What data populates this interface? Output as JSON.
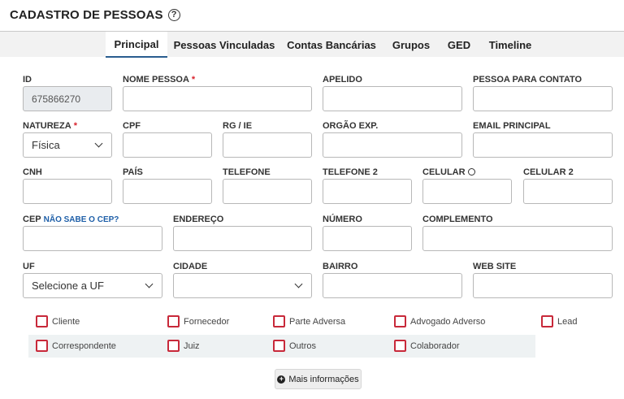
{
  "header": {
    "title": "CADASTRO DE PESSOAS",
    "help_icon": "?"
  },
  "tabs": [
    {
      "label": "Principal",
      "active": true
    },
    {
      "label": "Pessoas Vinculadas"
    },
    {
      "label": "Contas Bancárias"
    },
    {
      "label": "Grupos"
    },
    {
      "label": "GED"
    },
    {
      "label": "Timeline"
    }
  ],
  "form": {
    "id": {
      "label": "ID",
      "value": "675866270"
    },
    "nome": {
      "label": "NOME PESSOA",
      "required_mark": "*"
    },
    "apelido": {
      "label": "APELIDO"
    },
    "contato": {
      "label": "PESSOA PARA CONTATO"
    },
    "natureza": {
      "label": "NATUREZA",
      "required_mark": "*",
      "value": "Física"
    },
    "cpf": {
      "label": "CPF"
    },
    "rg": {
      "label": "RG / IE"
    },
    "orgao": {
      "label": "ORGÃO EXP."
    },
    "email": {
      "label": "EMAIL PRINCIPAL"
    },
    "cnh": {
      "label": "CNH"
    },
    "pais": {
      "label": "PAÍS"
    },
    "telefone": {
      "label": "TELEFONE"
    },
    "telefone2": {
      "label": "TELEFONE 2"
    },
    "celular": {
      "label": "CELULAR"
    },
    "celular2": {
      "label": "CELULAR 2"
    },
    "cep": {
      "label": "CEP",
      "link": "NÃO SABE O CEP?"
    },
    "endereco": {
      "label": "ENDEREÇO"
    },
    "numero": {
      "label": "NÚMERO"
    },
    "complemento": {
      "label": "COMPLEMENTO"
    },
    "uf": {
      "label": "UF",
      "value": "Selecione a UF"
    },
    "cidade": {
      "label": "CIDADE",
      "value": ""
    },
    "bairro": {
      "label": "BAIRRO"
    },
    "website": {
      "label": "WEB SITE"
    }
  },
  "checkboxes": [
    "Cliente",
    "Fornecedor",
    "Parte Adversa",
    "Advogado Adverso",
    "Lead",
    "Correspondente",
    "Juiz",
    "Outros",
    "Colaborador"
  ],
  "colors": {
    "accent": "#2a5d8f",
    "required": "#d9232d",
    "checkbox_border": "#c8293a",
    "link": "#1e5fa8"
  },
  "more_button": {
    "label": "Mais informações"
  }
}
